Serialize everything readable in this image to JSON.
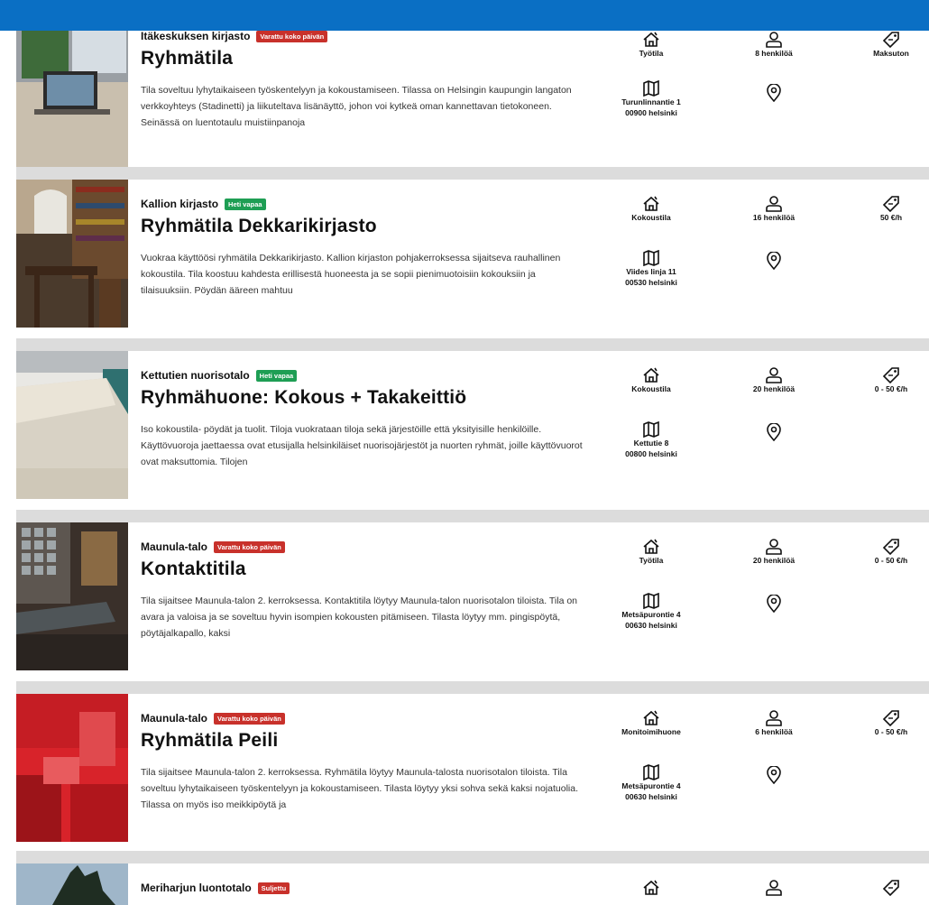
{
  "colors": {
    "top_bar": "#0a6fc4",
    "badge_reserved": "#c8312b",
    "badge_free": "#1e9e54",
    "separator": "#dcdcdc"
  },
  "icons": {
    "type": "house-icon",
    "capacity": "person-icon",
    "price": "tag-icon",
    "address": "map-icon",
    "location": "location-pin-icon"
  },
  "rooms": [
    {
      "venue": "Itäkeskuksen kirjasto",
      "status": "Varattu koko päivän",
      "status_kind": "red",
      "title": "Ryhmätila",
      "description": "Tila soveltuu lyhytaikaiseen työskentelyyn ja kokoustamiseen. Tilassa on Helsingin kaupungin langaton verkkoyhteys (Stadinetti) ja liikuteltava lisänäyttö, johon voi kytkeä oman kannettavan tietokoneen. Seinässä on luentotaulu muistiinpanoja",
      "type": "Työtila",
      "capacity": "8 henkilöä",
      "price": "Maksuton",
      "street": "Turunlinnantie 1",
      "postal": "00900 helsinki"
    },
    {
      "venue": "Kallion kirjasto",
      "status": "Heti vapaa",
      "status_kind": "green",
      "title": "Ryhmätila Dekkarikirjasto",
      "description": "Vuokraa käyttöösi ryhmätila Dekkarikirjasto. Kallion kirjaston pohjakerroksessa sijaitseva rauhallinen kokoustila.  Tila koostuu kahdesta erillisestä huoneesta ja se sopii pienimuotoisiin kokouksiin ja tilaisuuksiin. Pöydän ääreen mahtuu",
      "type": "Kokoustila",
      "capacity": "16 henkilöä",
      "price": "50 €/h",
      "street": "Viides linja 11",
      "postal": "00530 helsinki"
    },
    {
      "venue": "Kettutien nuorisotalo",
      "status": "Heti vapaa",
      "status_kind": "green",
      "title": "Ryhmähuone: Kokous + Takakeittiö",
      "description": "Iso kokoustila- pöydät ja tuolit.  Tiloja vuokrataan tiloja sekä järjestöille että yksityisille henkilöille.  Käyttövuoroja jaettaessa ovat etusijalla helsinkiläiset nuorisojärjestöt ja nuorten ryhmät, joille käyttövuorot ovat maksuttomia.  Tilojen",
      "type": "Kokoustila",
      "capacity": "20 henkilöä",
      "price": "0 - 50 €/h",
      "street": "Kettutie 8",
      "postal": "00800 helsinki"
    },
    {
      "venue": "Maunula-talo",
      "status": "Varattu koko päivän",
      "status_kind": "red",
      "title": "Kontaktitila",
      "description": "Tila sijaitsee Maunula-talon 2. kerroksessa. Kontaktitila löytyy Maunula-talon nuorisotalon tiloista. Tila on avara ja valoisa ja se soveltuu hyvin isompien kokousten pitämiseen. Tilasta löytyy mm. pingispöytä, pöytäjalkapallo, kaksi",
      "type": "Työtila",
      "capacity": "20 henkilöä",
      "price": "0 - 50 €/h",
      "street": "Metsäpurontie 4",
      "postal": "00630 helsinki"
    },
    {
      "venue": "Maunula-talo",
      "status": "Varattu koko päivän",
      "status_kind": "red",
      "title": "Ryhmätila Peili",
      "description": "Tila sijaitsee Maunula-talon 2. kerroksessa. Ryhmätila löytyy Maunula-talosta nuorisotalon tiloista. Tila soveltuu lyhytaikaiseen työskentelyyn ja kokoustamiseen. Tilasta löytyy yksi sohva sekä kaksi nojatuolia. Tilassa on myös iso meikkipöytä ja",
      "type": "Monitoimihuone",
      "capacity": "6 henkilöä",
      "price": "0 - 50 €/h",
      "street": "Metsäpurontie 4",
      "postal": "00630 helsinki"
    },
    {
      "venue": "Meriharjun luontotalo",
      "status": "Suljettu",
      "status_kind": "red"
    }
  ]
}
